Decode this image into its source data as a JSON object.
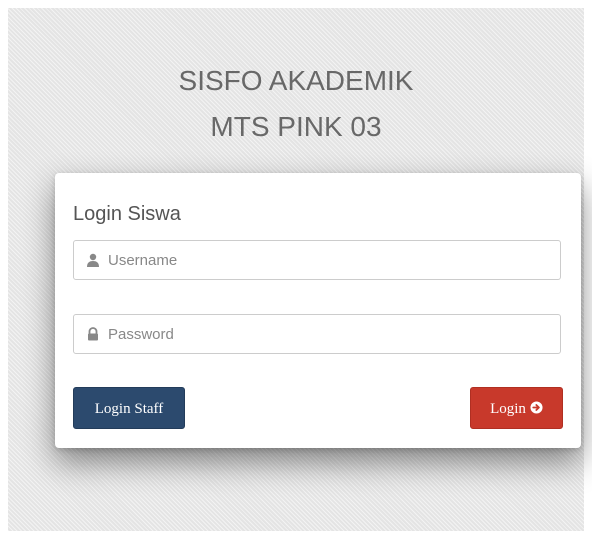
{
  "header": {
    "line1": "SISFO AKADEMIK",
    "line2": "MTS PINK 03"
  },
  "login_card": {
    "title": "Login Siswa",
    "username": {
      "placeholder": "Username",
      "value": "",
      "icon": "user-icon"
    },
    "password": {
      "placeholder": "Password",
      "value": "",
      "icon": "lock-icon"
    },
    "staff_button_label": "Login Staff",
    "login_button_label": "Login",
    "login_button_icon": "arrow-circle-right-icon"
  },
  "colors": {
    "staff_button": "#2c4a6e",
    "login_button": "#c8392b",
    "title_text": "#686868",
    "background": "#e4e4e4"
  }
}
